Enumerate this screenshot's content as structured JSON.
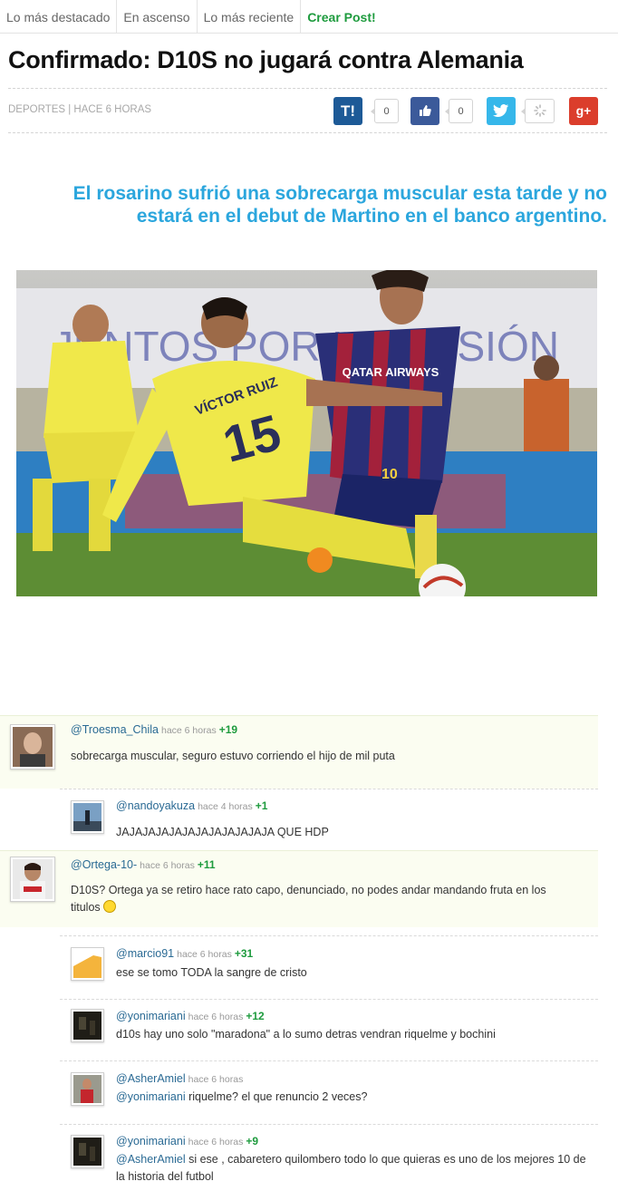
{
  "nav": {
    "tabs": [
      {
        "label": "Lo más destacado"
      },
      {
        "label": "En ascenso"
      },
      {
        "label": "Lo más reciente"
      },
      {
        "label": "Crear Post!"
      }
    ]
  },
  "post": {
    "title": "Confirmado: D10S no jugará contra Alemania",
    "meta": "DEPORTES | HACE 6 HORAS",
    "subtitle": "El rosarino sufrió una sobrecarga muscular esta tarde y no estará en el debut de Martino en el banco argentino.",
    "share": {
      "taringa_label": "T!",
      "taringa_count": "0",
      "like_label": "👍",
      "like_count": "0",
      "twitter_label": "🐦",
      "gplus_label": "g+"
    },
    "photo_text": {
      "banner": "JUNTOS POR LA ILUSIÓN",
      "jersey_name": "VÍCTOR RUIZ",
      "jersey_number": "15",
      "shirt_sponsor": "QATAR AIRWAYS",
      "shorts_number": "10"
    }
  },
  "comments": [
    {
      "user": "@Troesma_Chila",
      "time": "hace 6 horas",
      "points": "+19",
      "text": "sobrecarga muscular, seguro estuvo corriendo el hijo de mil puta"
    },
    {
      "user": "@nandoyakuza",
      "time": "hace 4 horas",
      "points": "+1",
      "text": "JAJAJAJAJAJAJAJAJAJAJAJA QUE HDP"
    },
    {
      "user": "@Ortega-10-",
      "time": "hace 6 horas",
      "points": "+11",
      "text": "D10S? Ortega ya se retiro hace rato capo, denunciado, no podes andar mandando fruta en los titulos"
    },
    {
      "user": "@marcio91",
      "time": "hace 6 horas",
      "points": "+31",
      "text": "ese se tomo TODA la sangre de cristo"
    },
    {
      "user": "@yonimariani",
      "time": "hace 6 horas",
      "points": "+12",
      "text": "d10s hay uno solo \"maradona\" a lo sumo detras vendran riquelme y bochini"
    },
    {
      "user": "@AsherAmiel",
      "time": "hace 6 horas",
      "points": "",
      "mention": "@yonimariani",
      "text": " riquelme? el que renuncio 2 veces?"
    },
    {
      "user": "@yonimariani",
      "time": "hace 6 horas",
      "points": "+9",
      "mention": "@AsherAmiel",
      "text": " si ese , cabaretero quilombero todo lo que quieras es uno de los mejores 10 de la historia del futbol"
    }
  ]
}
